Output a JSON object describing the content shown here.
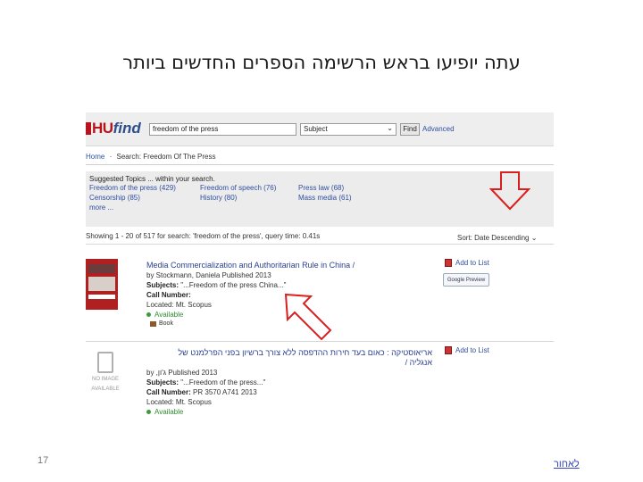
{
  "slide": {
    "title": "עתה יופיעו בראש הרשימה הספרים החדשים ביותר",
    "page_number": "17",
    "back_link": "לאחור"
  },
  "app": {
    "logo_hu": "HU",
    "logo_find": "find",
    "search_value": "freedom of the press",
    "search_type": "Subject",
    "find_button": "Find",
    "advanced_link": "Advanced"
  },
  "breadcrumb": {
    "home": "Home",
    "separator": "·",
    "current": "Search: Freedom Of The Press"
  },
  "topics": {
    "header": "Suggested Topics ... within your search.",
    "row1": [
      "Freedom of the press (429)",
      "Freedom of speech (76)",
      "Press law (68)"
    ],
    "row2": [
      "Censorship (85)",
      "History (80)",
      "Mass media (61)"
    ],
    "more": "more ..."
  },
  "results_bar": {
    "showing": "Showing 1 - 20 of 517 for search: 'freedom of the press', query time: 0.41s",
    "sort": "Sort: Date Descending"
  },
  "results": [
    {
      "title": "Media Commercialization and Authoritarian Rule in China /",
      "by": "by Stockmann, Daniela Published 2013",
      "subjects_label": "Subjects:",
      "subjects_value": "\"...Freedom of the press China...\"",
      "call_label": "Call Number:",
      "call_value": "",
      "located": "Located: Mt. Scopus",
      "available": "Available",
      "format": "Book",
      "add_to_list": "Add to List",
      "preview": "Google Preview"
    },
    {
      "title": "אריאוסטיקה : כאום בעד חירות ההדפסה ללא צורך ברשיון בפני הפרלמנט של",
      "title_line2": "אנגליה /",
      "by": "by ,ג'ון Published 2013",
      "subjects_label": "Subjects:",
      "subjects_value": "\"...Freedom of the press...\"",
      "call_label": "Call Number:",
      "call_value": "PR 3570 A741 2013",
      "located": "Located: Mt. Scopus",
      "available": "Available",
      "add_to_list": "Add to List",
      "no_image": "NO IMAGE",
      "no_image2": "AVAILABLE"
    }
  ],
  "colors": {
    "arrow_red": "#d8201f",
    "link_blue": "#2f4fa0",
    "logo_red": "#b8141c"
  }
}
